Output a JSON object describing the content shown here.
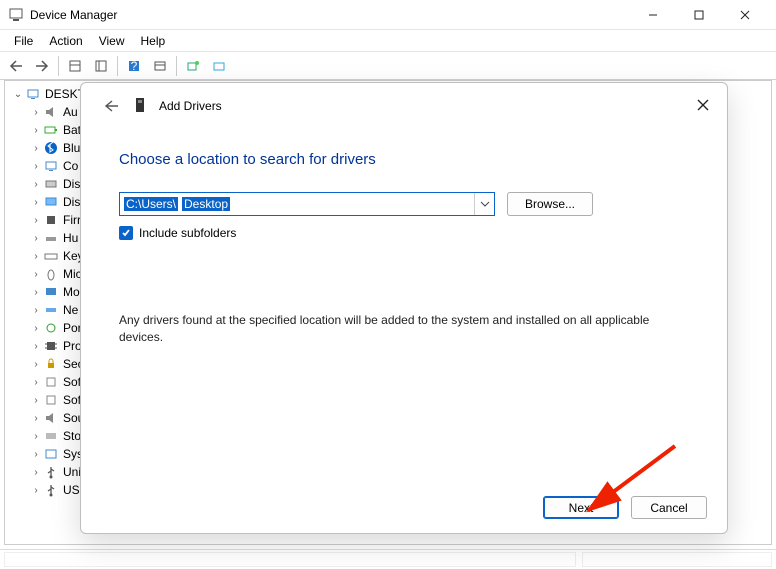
{
  "window": {
    "title": "Device Manager",
    "menus": [
      "File",
      "Action",
      "View",
      "Help"
    ]
  },
  "tree": {
    "root": "DESKTO",
    "items": [
      {
        "label": "Au",
        "icon": "speaker"
      },
      {
        "label": "Bat",
        "icon": "battery"
      },
      {
        "label": "Blu",
        "icon": "bluetooth"
      },
      {
        "label": "Co",
        "icon": "computer"
      },
      {
        "label": "Dis",
        "icon": "disk"
      },
      {
        "label": "Dis",
        "icon": "display"
      },
      {
        "label": "Firr",
        "icon": "firmware"
      },
      {
        "label": "Hu",
        "icon": "hid"
      },
      {
        "label": "Key",
        "icon": "keyboard"
      },
      {
        "label": "Mic",
        "icon": "mouse"
      },
      {
        "label": "Mo",
        "icon": "monitor"
      },
      {
        "label": "Ne",
        "icon": "network"
      },
      {
        "label": "Por",
        "icon": "port"
      },
      {
        "label": "Pro",
        "icon": "chip"
      },
      {
        "label": "Sec",
        "icon": "security"
      },
      {
        "label": "Sof",
        "icon": "software"
      },
      {
        "label": "Sof",
        "icon": "software"
      },
      {
        "label": "Sou",
        "icon": "sound"
      },
      {
        "label": "Sto",
        "icon": "storage"
      },
      {
        "label": "Sys",
        "icon": "system"
      },
      {
        "label": "Uni",
        "icon": "usb"
      },
      {
        "label": "USE",
        "icon": "usb"
      }
    ]
  },
  "dialog": {
    "title": "Add Drivers",
    "heading": "Choose a location to search for drivers",
    "path_a": "C:\\Users\\",
    "path_gap": "          ",
    "path_b": "Desktop",
    "browse": "Browse...",
    "include_label": "Include subfolders",
    "include_checked": true,
    "description": "Any drivers found at the specified location will be added to the system and installed on all applicable devices.",
    "next": "Next",
    "cancel": "Cancel"
  }
}
